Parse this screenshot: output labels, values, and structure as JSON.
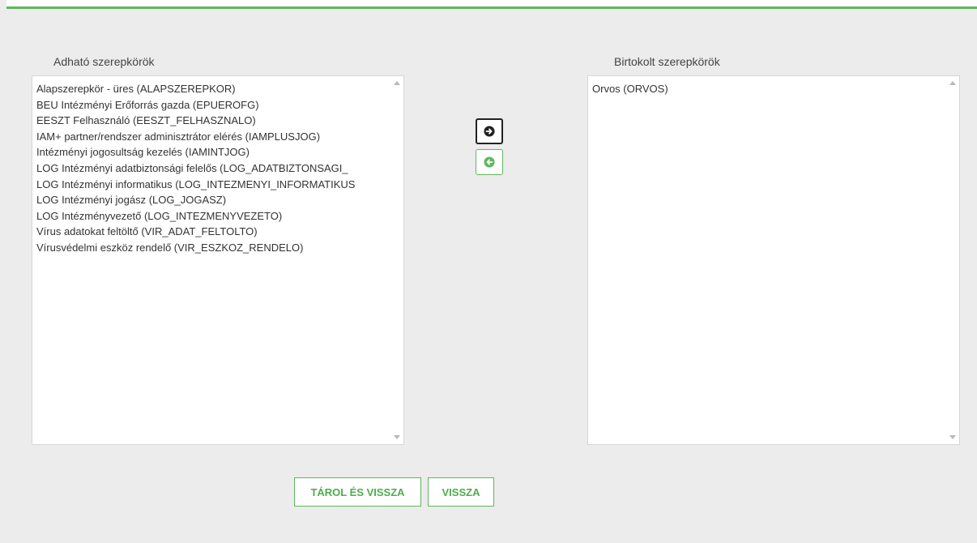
{
  "available_roles": {
    "label": "Adható szerepkörök",
    "items": [
      "Alapszerepkör - üres (ALAPSZEREPKOR)",
      "BEU Intézményi Erőforrás gazda (EPUEROFG)",
      "EESZT Felhasználó (EESZT_FELHASZNALO)",
      "IAM+ partner/rendszer adminisztrátor elérés (IAMPLUSJOG)",
      "Intézményi jogosultság kezelés (IAMINTJOG)",
      "LOG Intézményi adatbiztonsági felelős (LOG_ADATBIZTONSAGI_",
      "LOG Intézményi informatikus (LOG_INTEZMENYI_INFORMATIKUS",
      "LOG Intézményi jogász (LOG_JOGASZ)",
      "LOG Intézményvezető (LOG_INTEZMENYVEZETO)",
      "Vírus adatokat feltöltő (VIR_ADAT_FELTOLTO)",
      "Vírusvédelmi eszköz rendelő (VIR_ESZKOZ_RENDELO)"
    ]
  },
  "owned_roles": {
    "label": "Birtokolt szerepkörök",
    "items": [
      "Orvos (ORVOS)"
    ]
  },
  "transfer": {
    "move_right_icon": "arrow-circle-right-icon",
    "move_left_icon": "arrow-circle-left-icon"
  },
  "actions": {
    "save_and_back_label": "TÁROL ÉS VISSZA",
    "back_label": "VISSZA"
  },
  "colors": {
    "accent": "#5cb85c",
    "accent_text": "#4cae4c",
    "background": "#ececec"
  }
}
